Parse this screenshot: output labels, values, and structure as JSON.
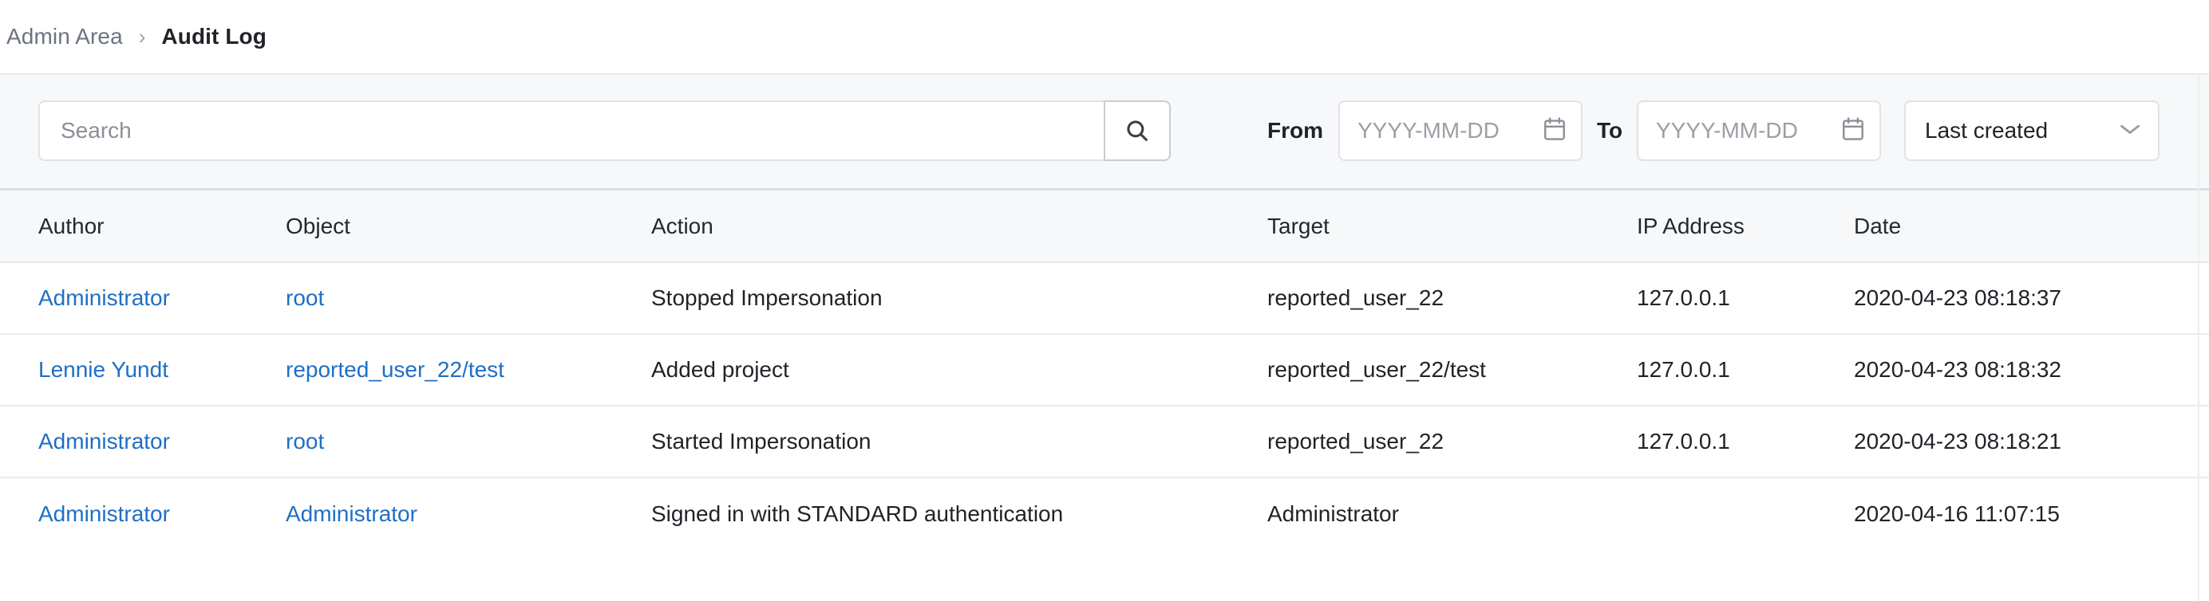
{
  "breadcrumb": {
    "parent": "Admin Area",
    "separator": "›",
    "current": "Audit Log"
  },
  "filters": {
    "search": {
      "value": "",
      "placeholder": "Search",
      "button_icon": "search-icon"
    },
    "from": {
      "label": "From",
      "value": "",
      "placeholder": "YYYY-MM-DD",
      "icon": "calendar-icon"
    },
    "to": {
      "label": "To",
      "value": "",
      "placeholder": "YYYY-MM-DD",
      "icon": "calendar-icon"
    },
    "sort": {
      "selected": "Last created",
      "icon": "chevron-down-icon"
    }
  },
  "table": {
    "columns": [
      "Author",
      "Object",
      "Action",
      "Target",
      "IP Address",
      "Date"
    ],
    "rows": [
      {
        "author": "Administrator",
        "object": "root",
        "action": "Stopped Impersonation",
        "target": "reported_user_22",
        "ip": "127.0.0.1",
        "date": "2020-04-23 08:18:37"
      },
      {
        "author": "Lennie Yundt",
        "object": "reported_user_22/test",
        "action": "Added project",
        "target": "reported_user_22/test",
        "ip": "127.0.0.1",
        "date": "2020-04-23 08:18:32"
      },
      {
        "author": "Administrator",
        "object": "root",
        "action": "Started Impersonation",
        "target": "reported_user_22",
        "ip": "127.0.0.1",
        "date": "2020-04-23 08:18:21"
      },
      {
        "author": "Administrator",
        "object": "Administrator",
        "action": "Signed in with STANDARD authentication",
        "target": "Administrator",
        "ip": "",
        "date": "2020-04-16 11:07:15"
      }
    ]
  },
  "colors": {
    "link": "#1f6fc4",
    "text": "#1f2328",
    "muted": "#6b7280",
    "bar_bg": "#f7f8f9",
    "border": "#e9ebed"
  }
}
